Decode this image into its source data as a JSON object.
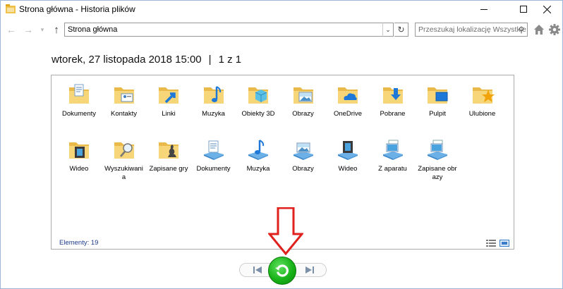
{
  "window": {
    "title": "Strona główna - Historia plików"
  },
  "navbar": {
    "address": "Strona główna",
    "search_placeholder": "Przeszukaj lokalizację Wszystkie"
  },
  "heading": {
    "date": "wtorek, 27 listopada 2018 15:00",
    "separator": "|",
    "counter": "1 z 1"
  },
  "items": [
    {
      "label": "Dokumenty",
      "icon": "folder-documents-icon"
    },
    {
      "label": "Kontakty",
      "icon": "folder-contacts-icon"
    },
    {
      "label": "Linki",
      "icon": "folder-links-icon"
    },
    {
      "label": "Muzyka",
      "icon": "folder-music-icon"
    },
    {
      "label": "Obiekty 3D",
      "icon": "folder-3d-objects-icon"
    },
    {
      "label": "Obrazy",
      "icon": "folder-pictures-icon"
    },
    {
      "label": "OneDrive",
      "icon": "folder-onedrive-icon"
    },
    {
      "label": "Pobrane",
      "icon": "folder-downloads-icon"
    },
    {
      "label": "Pulpit",
      "icon": "folder-desktop-icon"
    },
    {
      "label": "Ulubione",
      "icon": "folder-favorites-icon"
    },
    {
      "label": "Wideo",
      "icon": "folder-videos-icon"
    },
    {
      "label": "Wyszukiwania",
      "icon": "folder-searches-icon"
    },
    {
      "label": "Zapisane gry",
      "icon": "folder-saved-games-icon"
    },
    {
      "label": "Dokumenty",
      "icon": "library-documents-icon"
    },
    {
      "label": "Muzyka",
      "icon": "library-music-icon"
    },
    {
      "label": "Obrazy",
      "icon": "library-pictures-icon"
    },
    {
      "label": "Wideo",
      "icon": "library-videos-icon"
    },
    {
      "label": "Z aparatu",
      "icon": "library-camera-roll-icon"
    },
    {
      "label": "Zapisane obrazy",
      "icon": "library-saved-pictures-icon"
    }
  ],
  "status": {
    "count_text": "Elementy: 19"
  },
  "colors": {
    "folder": "#f7d67a",
    "folder_dark": "#e9b949",
    "accent_blue": "#1e78d7",
    "restore_green": "#18b318",
    "annotation_red": "#e0201c"
  }
}
